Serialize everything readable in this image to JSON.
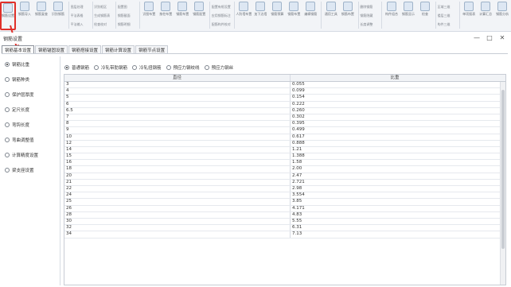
{
  "ribbon": {
    "groups": [
      {
        "large": [
          {
            "label": "钢筋设置",
            "highlight": true
          },
          {
            "label": "钢筋导入"
          },
          {
            "label": "钢筋复查"
          },
          {
            "label": "识别钢筋"
          }
        ]
      },
      {
        "small": [
          "图层处理",
          "平法表格",
          "平法输入"
        ]
      },
      {
        "small": [
          "识别框区",
          "生成钢筋表",
          "检查校对"
        ]
      },
      {
        "small": [
          "配置图",
          "钢筋截面",
          "钢筋明细"
        ]
      },
      {
        "large": [
          {
            "label": "识图布置"
          },
          {
            "label": "按柱布置"
          },
          {
            "label": "钢筋布置"
          },
          {
            "label": "钢筋配置"
          }
        ]
      },
      {
        "small": [
          "配置有框设置",
          "应用钢筋标注",
          "配筋构件校对"
        ]
      },
      {
        "large": [
          {
            "label": "人防墙布置"
          },
          {
            "label": "加下边墙"
          },
          {
            "label": "钢筋预算"
          },
          {
            "label": "钢筋布置"
          },
          {
            "label": "编辑钢筋"
          }
        ]
      },
      {
        "large": [
          {
            "label": "通用工具"
          },
          {
            "label": "钢筋布置"
          }
        ]
      },
      {
        "small": [
          "删除钢筋",
          "钢筋隐藏",
          "长度调整"
        ]
      },
      {
        "large": [
          {
            "label": "构件组合"
          },
          {
            "label": "钢筋显示"
          },
          {
            "label": "检查"
          }
        ]
      },
      {
        "small": [
          "区域三维",
          "楼层三维",
          "构件三维"
        ]
      },
      {
        "large": [
          {
            "label": "单项报表"
          },
          {
            "label": "计算汇总"
          },
          {
            "label": "钢筋分析"
          }
        ]
      }
    ]
  },
  "dialog": {
    "title": "钢筋设置",
    "minimize": "—",
    "maximize": "□",
    "close": "✕"
  },
  "tabs": [
    "钢筋基本设置",
    "钢筋锚固设置",
    "钢筋搭接设置",
    "钢筋计算设置",
    "钢筋节点设置"
  ],
  "left_options": [
    "钢筋比重",
    "钢筋种类",
    "保护层厚度",
    "定尺长度",
    "弯钩长度",
    "弯曲调整值",
    "计算精度设置",
    "梁支座设置"
  ],
  "sub_options": [
    "普通钢筋",
    "冷轧带肋钢筋",
    "冷轧扭钢筋",
    "预应力钢绞线",
    "预应力钢丝"
  ],
  "table": {
    "headers": [
      "直径",
      "比重"
    ],
    "rows": [
      [
        "3",
        "0.055"
      ],
      [
        "4",
        "0.099"
      ],
      [
        "5",
        "0.154"
      ],
      [
        "6",
        "0.222"
      ],
      [
        "6.5",
        "0.260"
      ],
      [
        "7",
        "0.302"
      ],
      [
        "8",
        "0.395"
      ],
      [
        "9",
        "0.499"
      ],
      [
        "10",
        "0.617"
      ],
      [
        "12",
        "0.888"
      ],
      [
        "14",
        "1.21"
      ],
      [
        "15",
        "1.388"
      ],
      [
        "16",
        "1.58"
      ],
      [
        "18",
        "2.00"
      ],
      [
        "20",
        "2.47"
      ],
      [
        "21",
        "2.721"
      ],
      [
        "22",
        "2.98"
      ],
      [
        "24",
        "3.554"
      ],
      [
        "25",
        "3.85"
      ],
      [
        "26",
        "4.171"
      ],
      [
        "28",
        "4.83"
      ],
      [
        "30",
        "5.55"
      ],
      [
        "32",
        "6.31"
      ],
      [
        "34",
        "7.13"
      ]
    ]
  },
  "colors": {
    "highlight": "#e0302a"
  }
}
